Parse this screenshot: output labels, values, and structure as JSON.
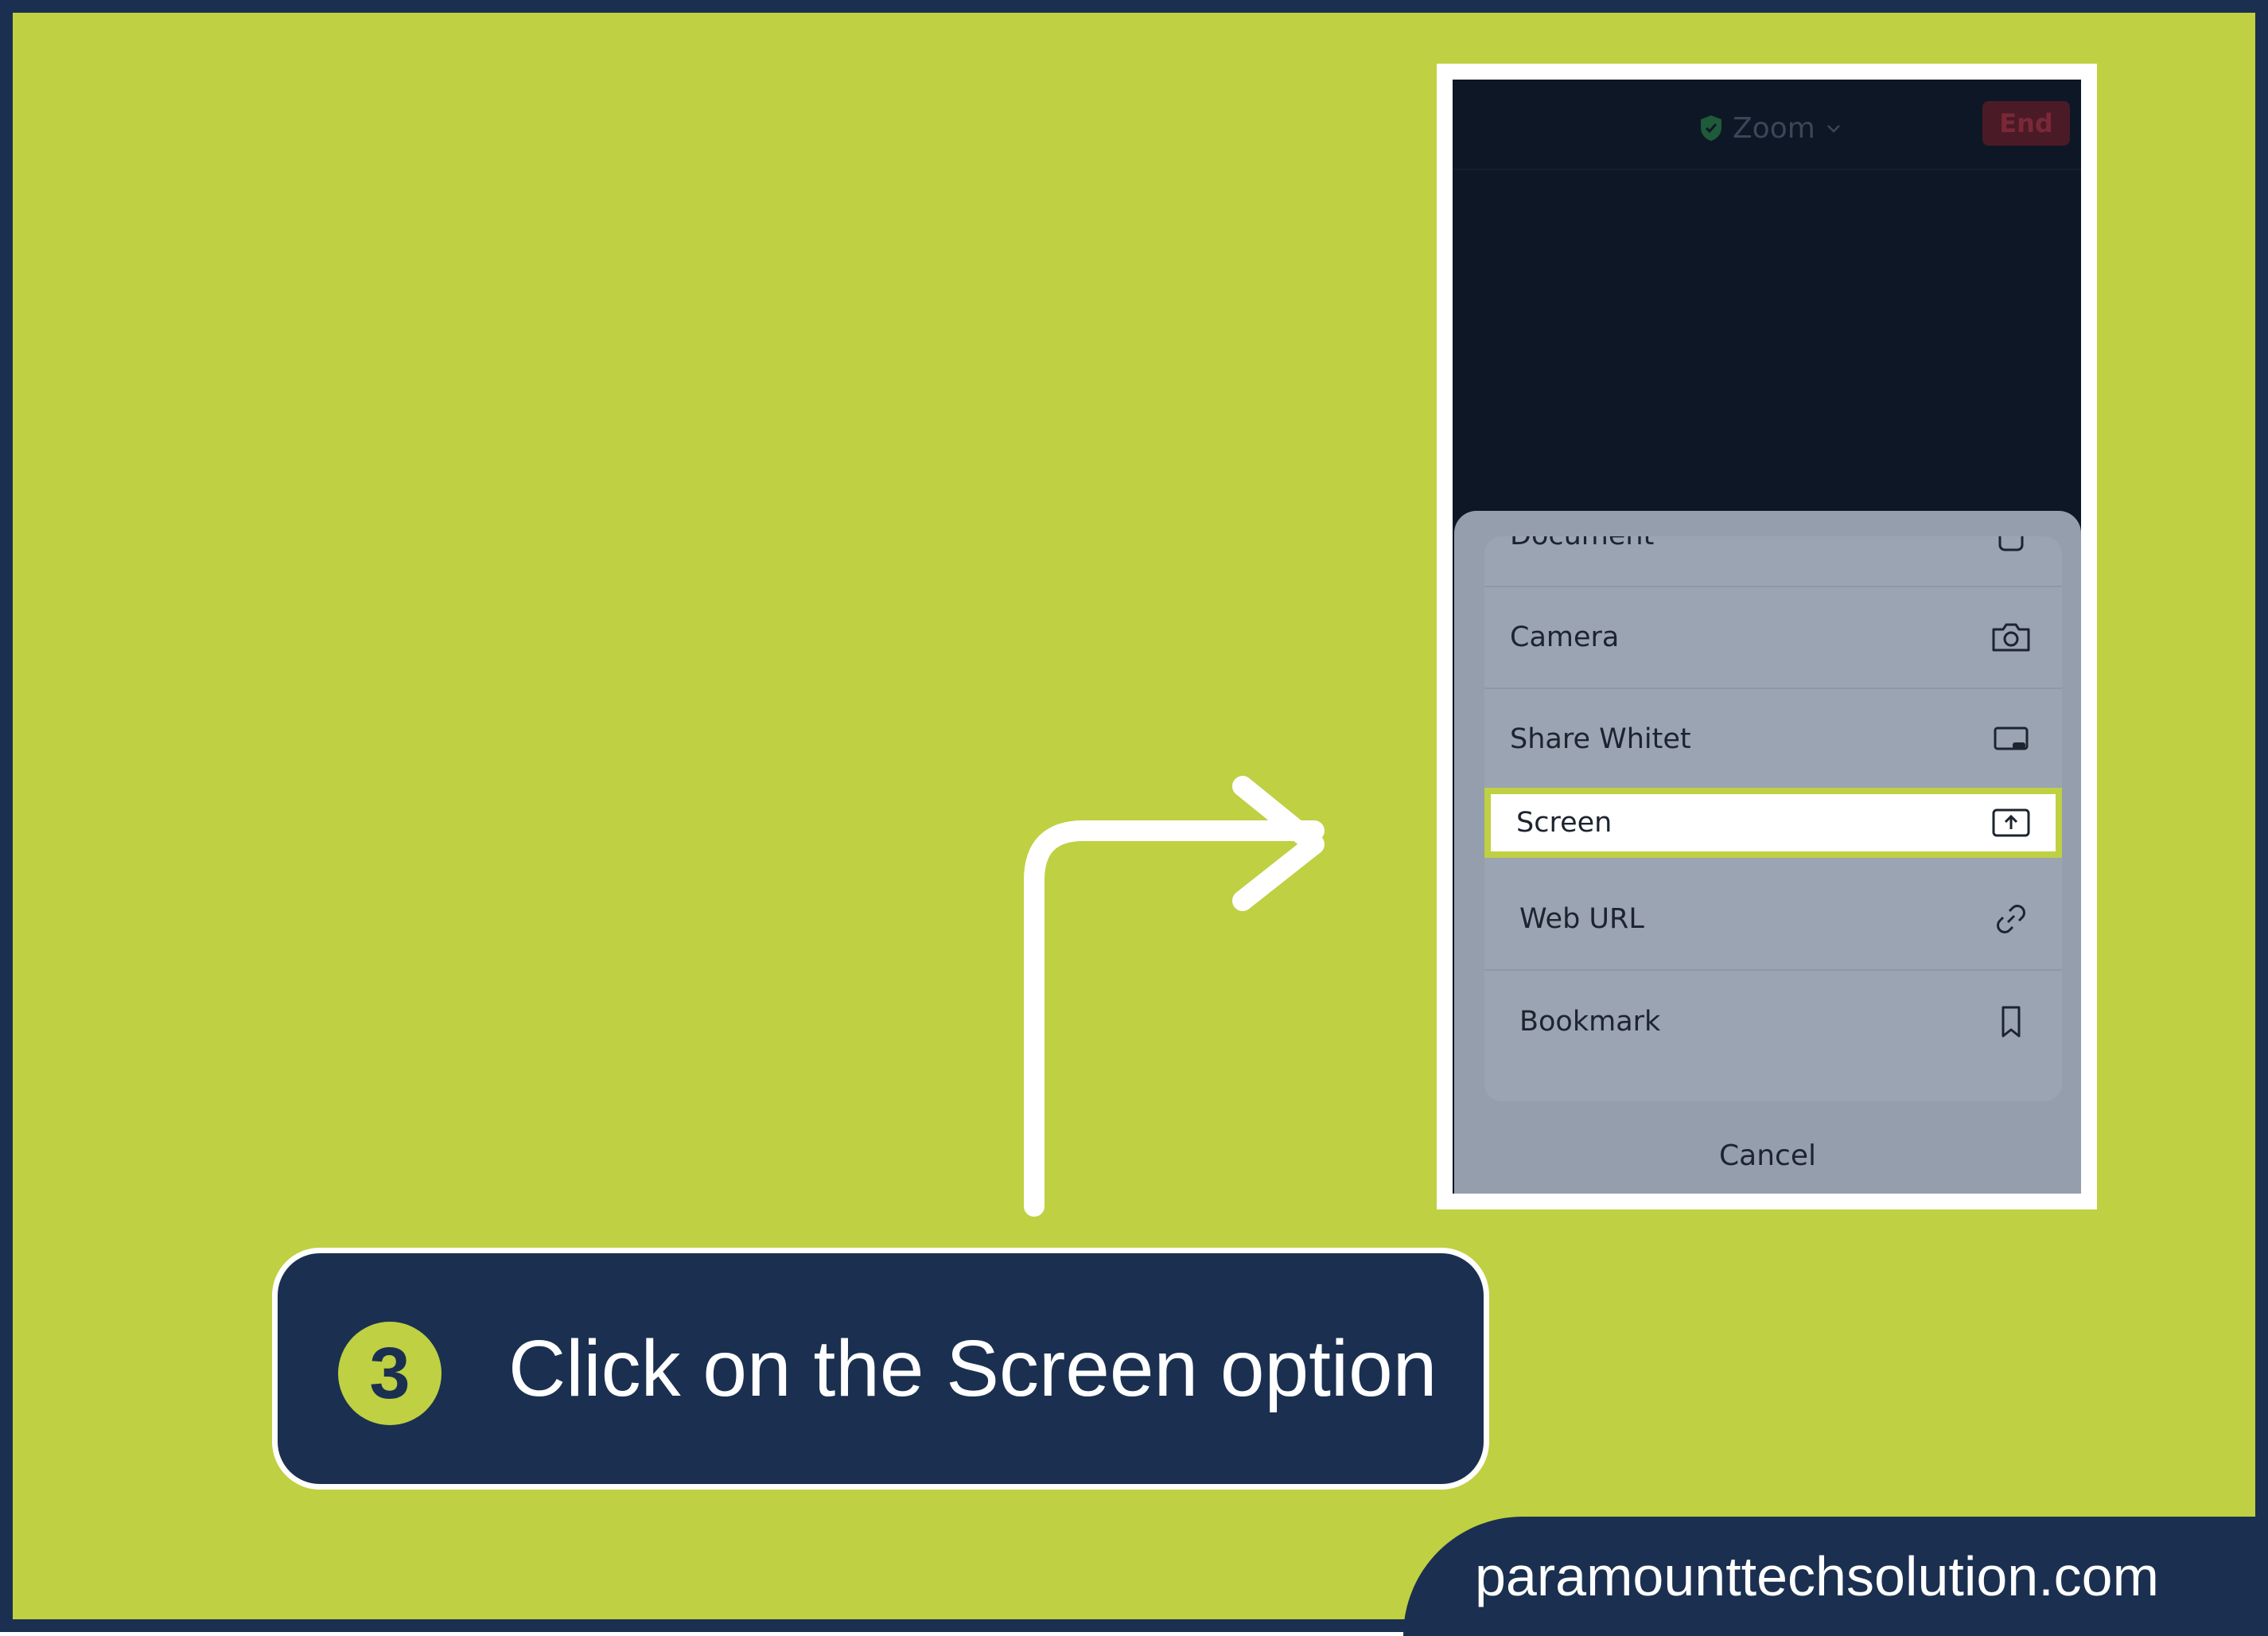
{
  "app": {
    "title": "Zoom",
    "end_label": "End"
  },
  "share_menu": {
    "items": [
      {
        "label": "Document",
        "icon": "document-icon"
      },
      {
        "label": "Camera",
        "icon": "camera-icon"
      },
      {
        "label": "Share Whitet",
        "icon": "whiteboard-icon"
      },
      {
        "label": "Screen",
        "icon": "share-screen-icon",
        "highlighted": true
      },
      {
        "label": "Web URL",
        "icon": "link-icon"
      },
      {
        "label": "Bookmark",
        "icon": "bookmark-icon"
      }
    ],
    "cancel_label": "Cancel"
  },
  "instruction": {
    "step_number": "3",
    "text": "Click on the Screen option"
  },
  "footer": {
    "site": "paramounttechsolution.com"
  },
  "colors": {
    "background": "#bfd042",
    "navy": "#1b3050",
    "highlight": "#bfd042",
    "end_button": "#4a1a26"
  }
}
